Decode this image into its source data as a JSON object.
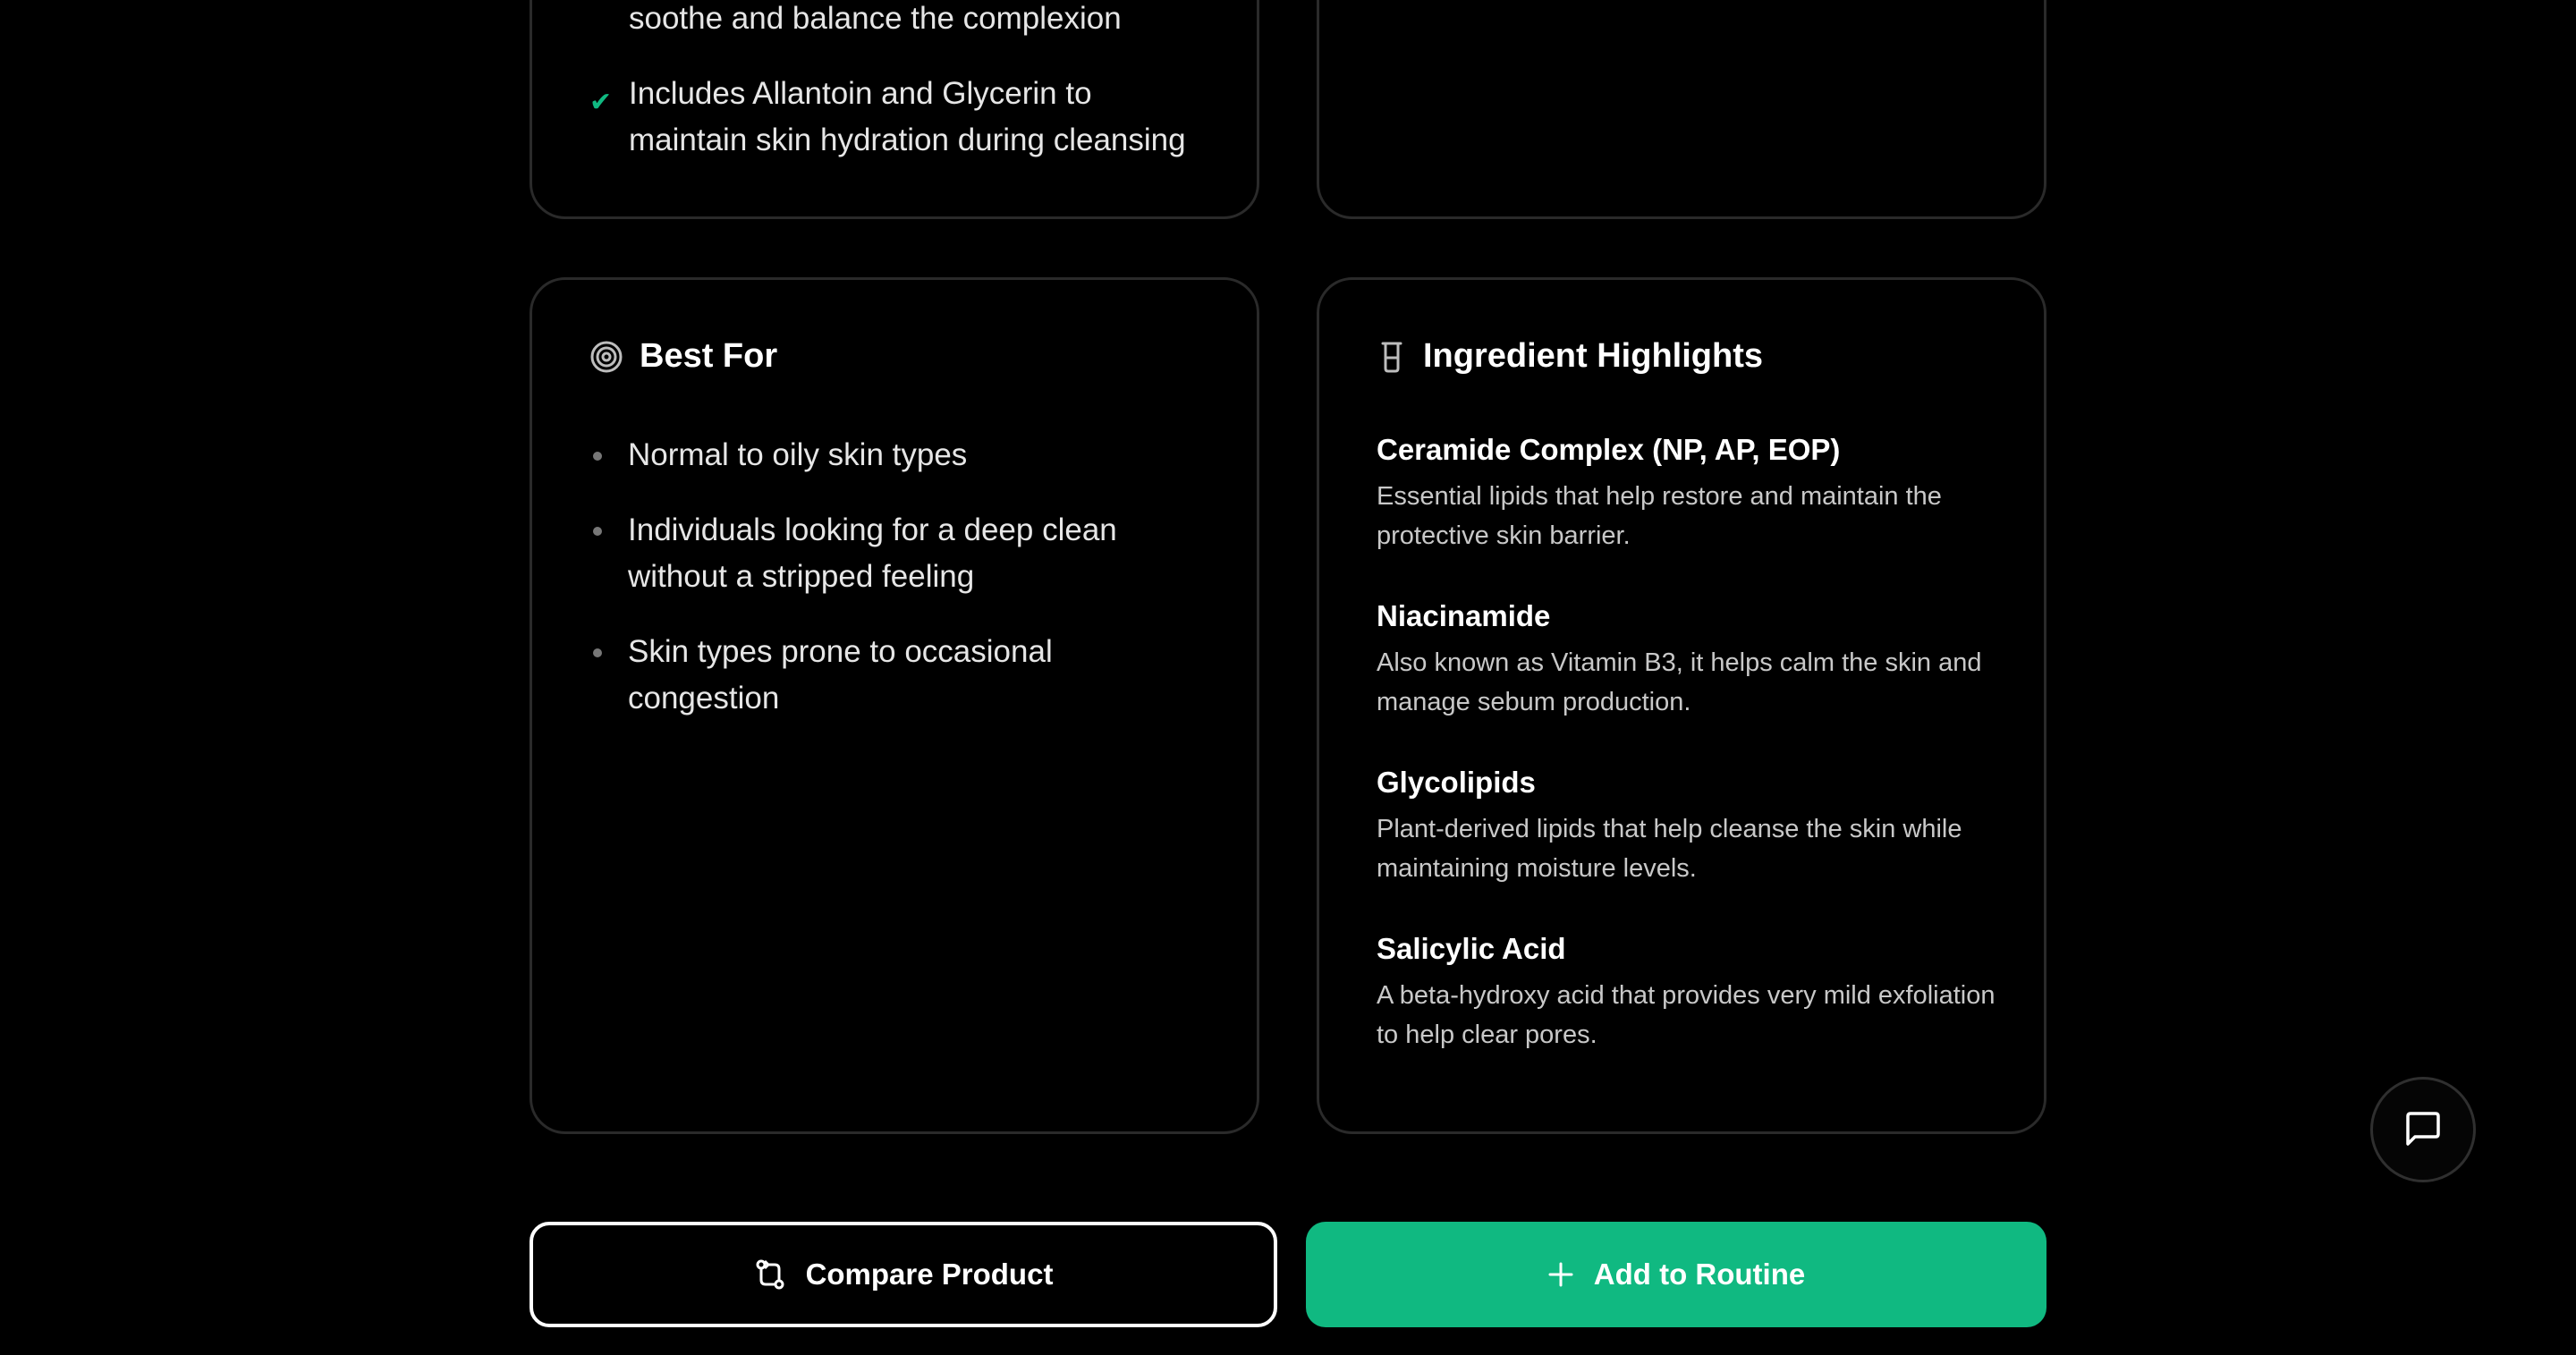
{
  "benefits": {
    "items": [
      "soothe and balance the complexion",
      "Includes Allantoin and Glycerin to maintain skin hydration during cleansing"
    ]
  },
  "best_for": {
    "title": "Best For",
    "icon": "target-icon",
    "items": [
      "Normal to oily skin types",
      "Individuals looking for a deep clean without a stripped feeling",
      "Skin types prone to occasional congestion"
    ]
  },
  "ingredients": {
    "title": "Ingredient Highlights",
    "icon": "beaker-icon",
    "items": [
      {
        "name": "Ceramide Complex (NP, AP, EOP)",
        "desc": "Essential lipids that help restore and maintain the protective skin barrier."
      },
      {
        "name": "Niacinamide",
        "desc": "Also known as Vitamin B3, it helps calm the skin and manage sebum production."
      },
      {
        "name": "Glycolipids",
        "desc": "Plant-derived lipids that help cleanse the skin while maintaining moisture levels."
      },
      {
        "name": "Salicylic Acid",
        "desc": "A beta-hydroxy acid that provides very mild exfoliation to help clear pores."
      }
    ]
  },
  "actions": {
    "compare_label": "Compare Product",
    "add_label": "Add to Routine"
  },
  "colors": {
    "accent": "#10b981",
    "background": "#000000",
    "card_border": "#2a2a2a"
  }
}
